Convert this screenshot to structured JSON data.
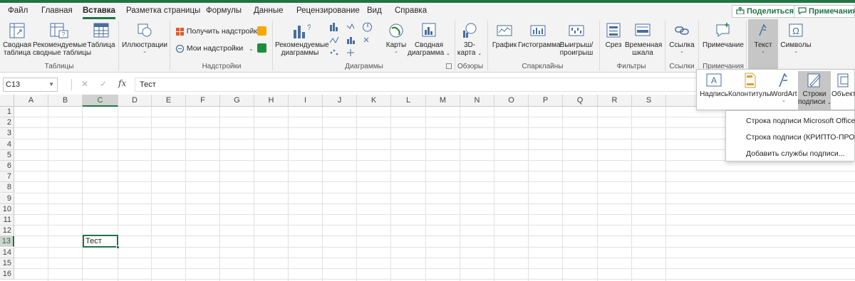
{
  "tabs": [
    "Файл",
    "Главная",
    "Вставка",
    "Разметка страницы",
    "Формулы",
    "Данные",
    "Рецензирование",
    "Вид",
    "Справка"
  ],
  "active_tab": "Вставка",
  "share_button": "Поделиться",
  "comments_button": "Примечания",
  "ribbon": {
    "tables": {
      "pivot_l1": "Сводная",
      "pivot_l2": "таблица",
      "recpivot_l1": "Рекомендуемые",
      "recpivot_l2": "сводные таблицы",
      "table": "Таблица",
      "group": "Таблицы"
    },
    "illustrations": {
      "label": "Иллюстрации",
      "group": ""
    },
    "addins": {
      "get": "Получить надстройки",
      "my": "Мои надстройки",
      "group": "Надстройки"
    },
    "charts": {
      "recommended_l1": "Рекомендуемые",
      "recommended_l2": "диаграммы",
      "maps": "Карты",
      "pivotchart_l1": "Сводная",
      "pivotchart_l2": "диаграмма",
      "group": "Диаграммы"
    },
    "tours": {
      "l1": "3D-",
      "l2": "карта",
      "group": "Обзоры"
    },
    "sparklines": {
      "line": "График",
      "column": "Гистограмма",
      "winloss_l1": "Выигрыш/",
      "winloss_l2": "проигрыш",
      "group": "Спарклайны"
    },
    "filters": {
      "slicer": "Срез",
      "timeline_l1": "Временная",
      "timeline_l2": "шкала",
      "group": "Фильтры"
    },
    "links": {
      "link": "Ссылка",
      "group": "Ссылки"
    },
    "comments": {
      "comment": "Примечание",
      "group": "Примечания"
    },
    "text": {
      "label": "Текст"
    },
    "symbols": {
      "label": "Символы"
    }
  },
  "formula_bar": {
    "name_box": "C13",
    "fx": "fx",
    "value": "Тест"
  },
  "grid": {
    "columns": [
      "A",
      "B",
      "C",
      "D",
      "E",
      "F",
      "G",
      "H",
      "I",
      "J",
      "K",
      "L",
      "M",
      "N",
      "O",
      "P",
      "Q",
      "R",
      "S"
    ],
    "rows": [
      "1",
      "2",
      "3",
      "4",
      "5",
      "6",
      "7",
      "8",
      "9",
      "10",
      "11",
      "12",
      "13",
      "14",
      "15",
      "16"
    ],
    "active_cell_value": "Тест",
    "selected_column": "C",
    "selected_row": "13"
  },
  "text_panel": {
    "textbox": "Надпись",
    "headerfooter": "Колонтитулы",
    "wordart": "WordArt",
    "sigline_l1": "Строки",
    "sigline_l2": "подписи",
    "object": "Объект"
  },
  "signature_menu": [
    "Строка подписи Microsoft Office...",
    "Строка подписи (КРИПТО-ПРО)",
    "Добавить службы подписи..."
  ],
  "colors": {
    "accent": "#217346",
    "ribbon_bg": "#f3f3f3",
    "selected_tool": "#c6c6c6"
  }
}
